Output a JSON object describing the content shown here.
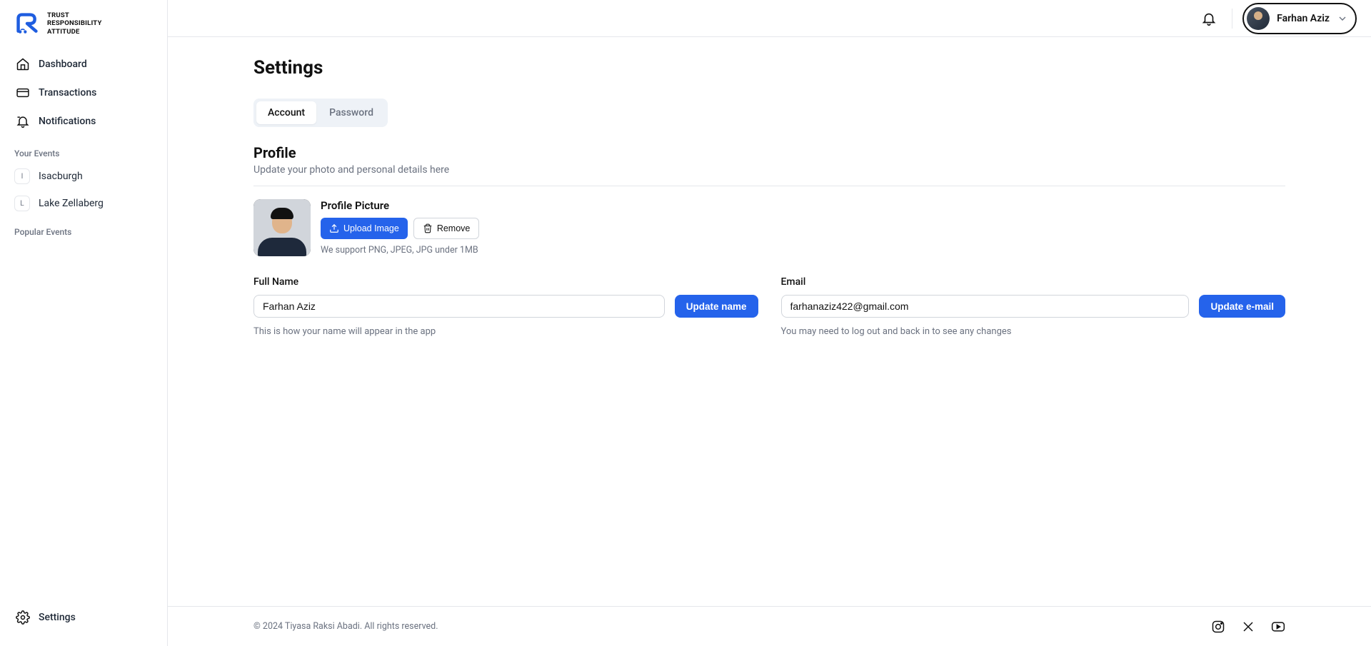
{
  "brand": {
    "line1": "TRUST",
    "line2": "RESPONSIBILITY",
    "line3": "ATTITUDE"
  },
  "nav": {
    "dashboard": "Dashboard",
    "transactions": "Transactions",
    "notifications": "Notifications",
    "settings": "Settings"
  },
  "yourEvents": {
    "label": "Your Events",
    "items": [
      {
        "initial": "I",
        "name": "Isacburgh"
      },
      {
        "initial": "L",
        "name": "Lake Zellaberg"
      }
    ]
  },
  "popularEvents": {
    "label": "Popular Events"
  },
  "header": {
    "userName": "Farhan Aziz"
  },
  "page": {
    "title": "Settings"
  },
  "tabs": {
    "account": "Account",
    "password": "Password"
  },
  "profile": {
    "title": "Profile",
    "subtitle": "Update your photo and personal details here",
    "pictureLabel": "Profile Picture",
    "uploadLabel": "Upload Image",
    "removeLabel": "Remove",
    "hint": "We support PNG, JPEG, JPG under 1MB"
  },
  "fullName": {
    "label": "Full Name",
    "value": "Farhan Aziz",
    "button": "Update name",
    "hint": "This is how your name will appear in the app"
  },
  "email": {
    "label": "Email",
    "value": "farhanaziz422@gmail.com",
    "button": "Update e-mail",
    "hint": "You may need to log out and back in to see any changes"
  },
  "footer": {
    "copyright": "© 2024 Tiyasa Raksi Abadi. All rights reserved."
  }
}
